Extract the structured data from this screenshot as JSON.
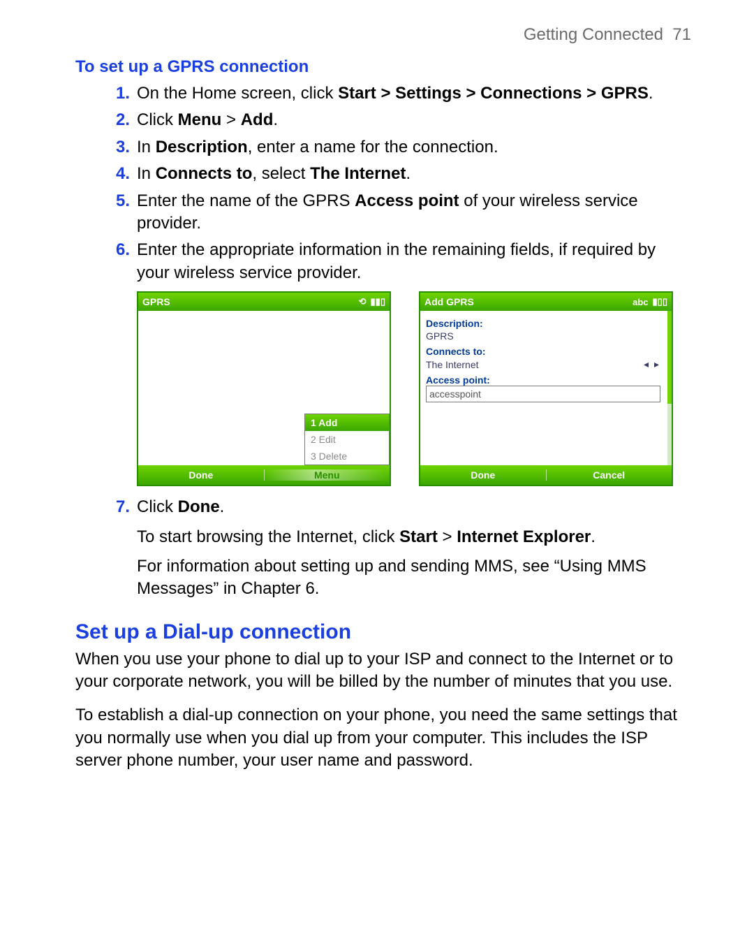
{
  "header": {
    "chapter": "Getting Connected",
    "page": "71"
  },
  "section1": {
    "title": "To set up a GPRS connection",
    "steps": {
      "s1": {
        "n": "1.",
        "pre": "On the Home screen, click ",
        "bold": "Start > Settings > Connections > GPRS",
        "post": "."
      },
      "s2": {
        "n": "2.",
        "pre": "Click ",
        "b1": "Menu",
        "mid": " > ",
        "b2": "Add",
        "post": "."
      },
      "s3": {
        "n": "3.",
        "pre": "In ",
        "b1": "Description",
        "post": ", enter a name for the connection."
      },
      "s4": {
        "n": "4.",
        "pre": "In ",
        "b1": "Connects to",
        "mid": ", select ",
        "b2": "The Internet",
        "post": "."
      },
      "s5": {
        "n": "5.",
        "pre": "Enter the name of the GPRS ",
        "b1": "Access point",
        "post": " of your wireless service provider."
      },
      "s6": {
        "n": "6.",
        "txt": "Enter the appropriate information in the remaining fields, if required by your wireless service provider."
      }
    }
  },
  "screen1": {
    "title": "GPRS",
    "icons": {
      "sync": "⟲",
      "signal": "▮▮▯"
    },
    "menu": {
      "i1": "1 Add",
      "i2": "2 Edit",
      "i3": "3 Delete"
    },
    "sk_left": "Done",
    "sk_right": "Menu"
  },
  "screen2": {
    "title": "Add GPRS",
    "indicator": "abc",
    "signal": "▮▯▯",
    "desc_label": "Description:",
    "desc_value": "GPRS",
    "conn_label": "Connects to:",
    "conn_value": "The Internet",
    "conn_arrows": "◂ ▸",
    "ap_label": "Access point:",
    "ap_value": "accesspoint",
    "sk_left": "Done",
    "sk_right": "Cancel"
  },
  "step7": {
    "n": "7.",
    "pre": "Click ",
    "b1": "Done",
    "post": ".",
    "browse_pre": "To start browsing the Internet, click ",
    "browse_b1": "Start",
    "browse_mid": " > ",
    "browse_b2": "Internet Explorer",
    "browse_post": ".",
    "mms": "For information about setting up and sending MMS, see “Using MMS Messages” in Chapter 6."
  },
  "section2": {
    "title": "Set up a Dial-up connection",
    "p1": "When you use your phone to dial up to your ISP and connect to the Internet or to your corporate network, you will be billed by the number of minutes that you use.",
    "p2": "To establish a dial-up connection on your phone, you need the same settings that you normally use when you dial up from your computer. This includes the ISP server phone number, your user name and password."
  }
}
